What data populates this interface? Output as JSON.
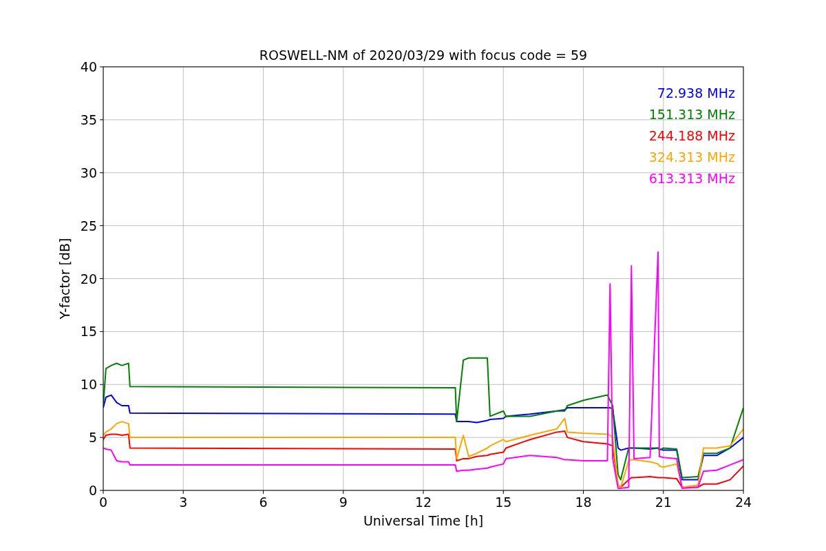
{
  "chart_data": {
    "type": "line",
    "title": "ROSWELL-NM of 2020/03/29 with focus code = 59",
    "xlabel": "Universal Time [h]",
    "ylabel": "Y-factor [dB]",
    "xlim": [
      0,
      24
    ],
    "ylim": [
      0,
      40
    ],
    "xticks": [
      0,
      3,
      6,
      9,
      12,
      15,
      18,
      21,
      24
    ],
    "yticks": [
      0,
      5,
      10,
      15,
      20,
      25,
      30,
      35,
      40
    ],
    "grid": true,
    "x": [
      0,
      0.1,
      0.3,
      0.5,
      0.7,
      0.95,
      1.0,
      13.2,
      13.25,
      13.5,
      13.7,
      14.0,
      14.4,
      14.5,
      15.0,
      15.1,
      16,
      17,
      17.3,
      17.4,
      18,
      18.9,
      19.0,
      19.1,
      19.3,
      19.4,
      19.7,
      19.8,
      19.9,
      20.5,
      20.8,
      20.85,
      21,
      21.5,
      21.7,
      22.3,
      22.5,
      23,
      23.5,
      24
    ],
    "series": [
      {
        "name": "72.938 MHz",
        "color": "#0000ff",
        "values": [
          7.8,
          8.8,
          9.0,
          8.3,
          8.0,
          8.0,
          7.3,
          7.2,
          6.5,
          6.5,
          6.5,
          6.4,
          6.6,
          6.7,
          6.8,
          7.0,
          7.2,
          7.5,
          7.6,
          7.8,
          7.8,
          7.8,
          7.8,
          7.7,
          4.0,
          3.8,
          4.0,
          4.0,
          4.0,
          3.9,
          4.0,
          3.9,
          3.8,
          3.8,
          1.0,
          1.0,
          3.3,
          3.3,
          4.0,
          5.0
        ]
      },
      {
        "name": "151.313 MHz",
        "color": "#008000",
        "values": [
          8.0,
          11.5,
          11.8,
          12.0,
          11.8,
          12.0,
          9.8,
          9.7,
          6.5,
          12.3,
          12.5,
          12.5,
          12.5,
          7.0,
          7.5,
          7.0,
          7.0,
          7.5,
          7.5,
          8.0,
          8.5,
          9.0,
          8.5,
          8.0,
          1.5,
          1.0,
          4.0,
          4.0,
          4.0,
          4.0,
          4.0,
          3.8,
          4.0,
          3.9,
          1.2,
          1.3,
          3.5,
          3.5,
          4.0,
          7.8
        ]
      },
      {
        "name": "244.188 MHz",
        "color": "#ff0000",
        "values": [
          4.8,
          5.2,
          5.3,
          5.3,
          5.2,
          5.3,
          4.0,
          3.9,
          2.8,
          3.0,
          3.0,
          3.2,
          3.3,
          3.4,
          3.6,
          4.0,
          4.8,
          5.5,
          5.6,
          5.0,
          4.6,
          4.4,
          4.3,
          4.2,
          0.5,
          0.3,
          1.0,
          1.2,
          1.2,
          1.3,
          1.2,
          1.2,
          1.2,
          1.1,
          0.3,
          0.3,
          0.6,
          0.6,
          1.0,
          2.3
        ]
      },
      {
        "name": "324.313 MHz",
        "color": "#ffa500",
        "values": [
          5.2,
          5.5,
          5.8,
          6.3,
          6.5,
          6.3,
          5.0,
          5.0,
          3.0,
          5.2,
          3.2,
          3.5,
          4.0,
          4.2,
          4.8,
          4.6,
          5.2,
          5.8,
          6.8,
          5.5,
          5.4,
          5.3,
          5.2,
          5.0,
          0.5,
          0.3,
          2.8,
          2.9,
          2.9,
          2.7,
          2.5,
          2.3,
          2.2,
          2.5,
          0.3,
          0.5,
          4.0,
          4.0,
          4.2,
          5.8
        ]
      },
      {
        "name": "613.313 MHz",
        "color": "#ff00ff",
        "values": [
          4.0,
          3.9,
          3.8,
          2.8,
          2.7,
          2.7,
          2.4,
          2.4,
          1.8,
          1.9,
          1.9,
          2.0,
          2.1,
          2.2,
          2.5,
          3.0,
          3.3,
          3.1,
          2.9,
          2.9,
          2.8,
          2.8,
          19.5,
          3.0,
          0.2,
          0.2,
          0.3,
          21.2,
          3.0,
          3.1,
          22.5,
          3.2,
          3.1,
          3.0,
          0.2,
          0.3,
          1.8,
          1.9,
          2.4,
          2.9
        ]
      }
    ]
  }
}
